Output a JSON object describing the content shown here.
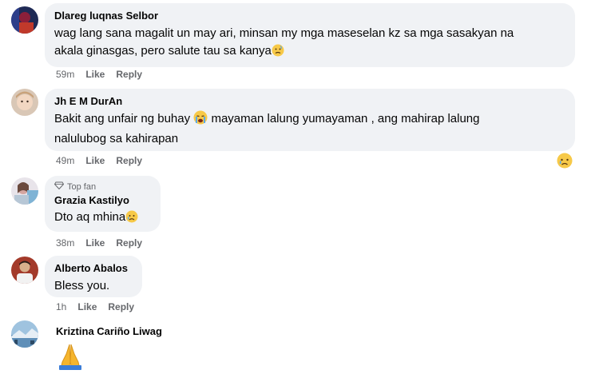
{
  "comments": [
    {
      "author": "Dlareg luqnas Selbor",
      "lines": [
        "wag lang sana magalit un may ari, minsan my mga maseselan kz sa mga sasakyan na",
        "akala ginasgas, pero salute tau sa kanya"
      ],
      "emoji": "worried-face",
      "time": "59m",
      "like": "Like",
      "reply": "Reply"
    },
    {
      "author": "Jh E M DurAn",
      "line1_a": "Bakit ang unfair ng buhay",
      "line1_b": "mayaman lalung yumayaman , ang mahirap lalung",
      "line2": "nalulubog sa kahirapan",
      "emoji": "crying-face",
      "reaction": "sad-face",
      "time": "49m",
      "like": "Like",
      "reply": "Reply"
    },
    {
      "badge": "Top fan",
      "author": "Grazia Kastilyo",
      "text": "Dto aq mhina",
      "emoji": "sad-face",
      "time": "38m",
      "like": "Like",
      "reply": "Reply"
    },
    {
      "author": "Alberto Abalos",
      "text": "Bless you.",
      "time": "1h",
      "like": "Like",
      "reply": "Reply"
    },
    {
      "author": "Kriztina Cariño Liwag",
      "emoji": "folded-hands"
    }
  ],
  "colors": {
    "bubble": "#f0f2f5",
    "meta": "#65676b",
    "text": "#050505"
  }
}
